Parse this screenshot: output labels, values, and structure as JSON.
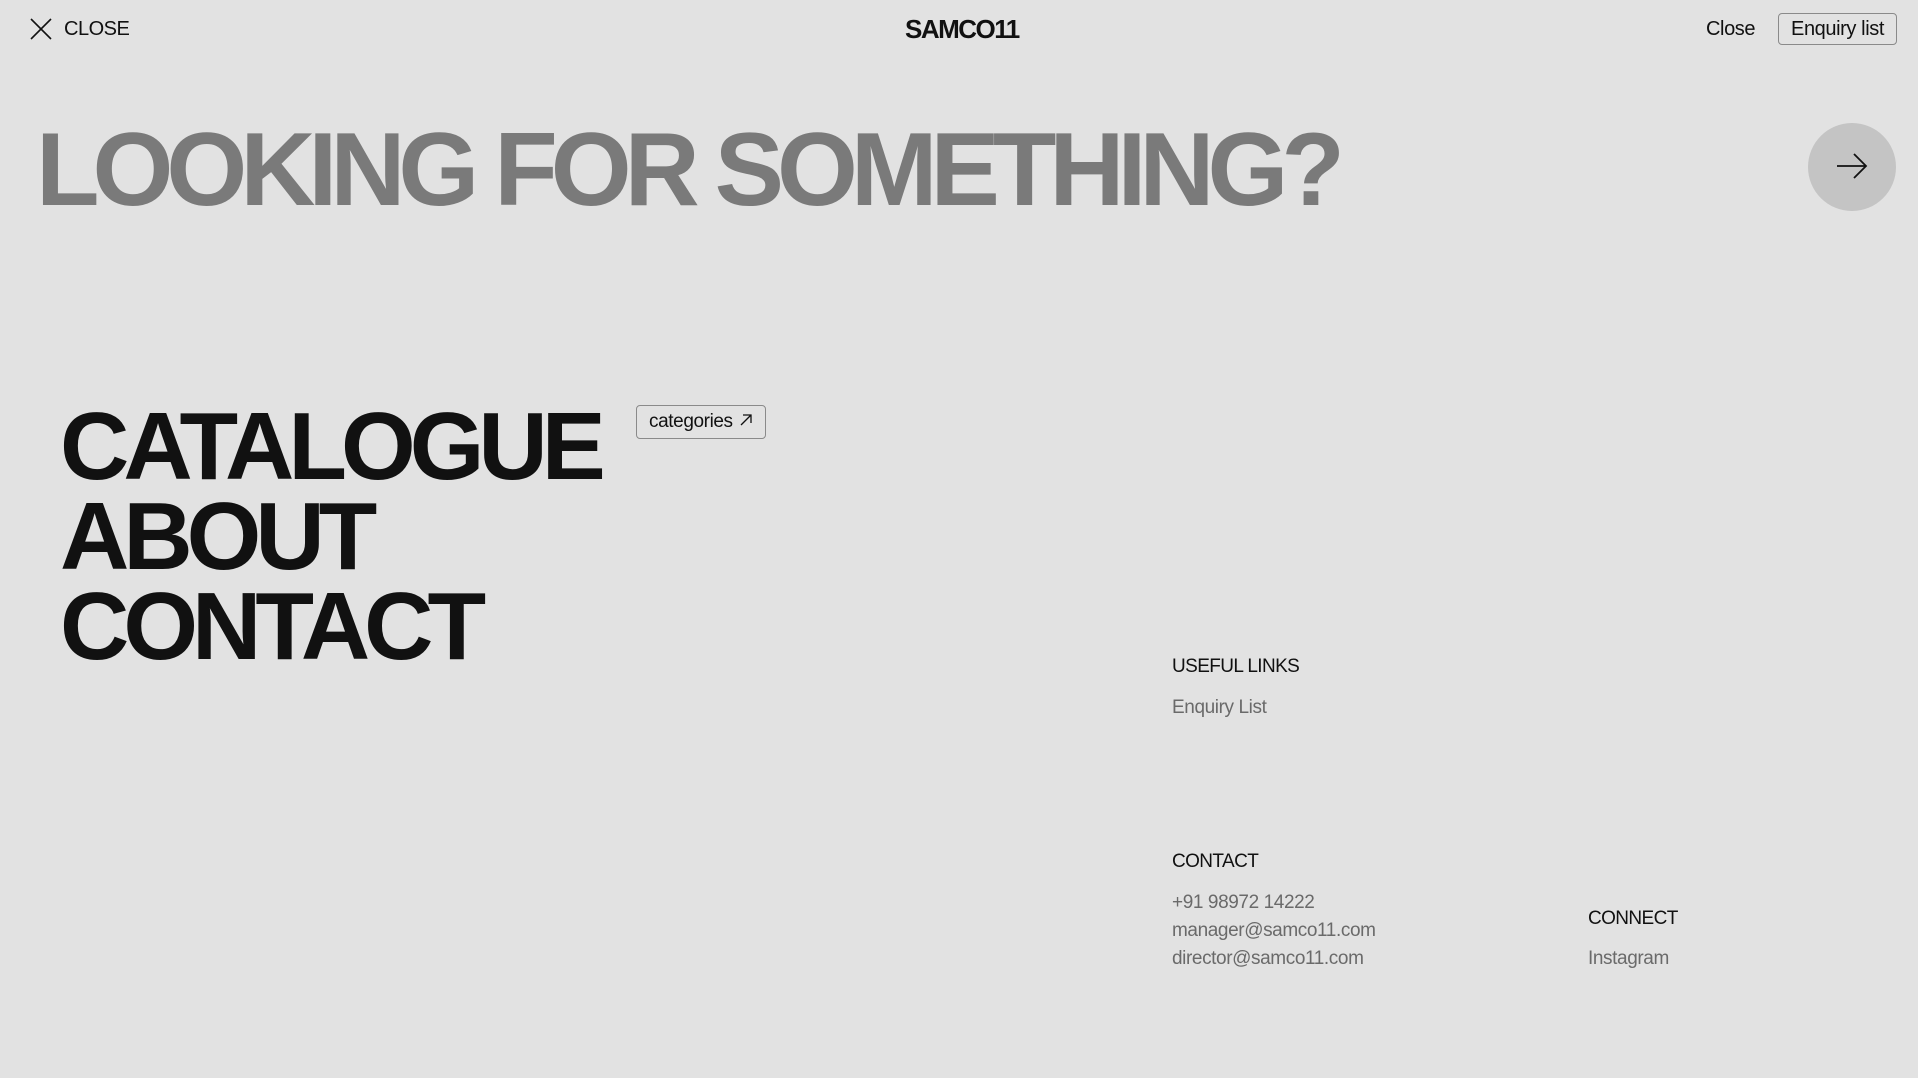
{
  "header": {
    "close_label": "CLOSE",
    "logo": "SAMCO11",
    "close_link": "Close",
    "enquiry_button": "Enquiry list"
  },
  "search": {
    "placeholder": "LOOKING FOR SOMETHING?",
    "value": ""
  },
  "nav": {
    "items": [
      {
        "label": "CATALOGUE"
      },
      {
        "label": "ABOUT"
      },
      {
        "label": "CONTACT"
      }
    ],
    "categories_button": "categories"
  },
  "useful_links": {
    "heading": "USEFUL LINKS",
    "links": [
      "Enquiry List"
    ]
  },
  "contact": {
    "heading": "CONTACT",
    "phone": "+91 98972 14222",
    "email_1": "manager@samco11.com",
    "email_2": "director@samco11.com"
  },
  "connect": {
    "heading": "CONNECT",
    "links": [
      "Instagram"
    ]
  },
  "colors": {
    "background": "#e2e2e2",
    "text": "#111111",
    "muted": "#7a7a7a",
    "circle": "#c4c4c4"
  }
}
